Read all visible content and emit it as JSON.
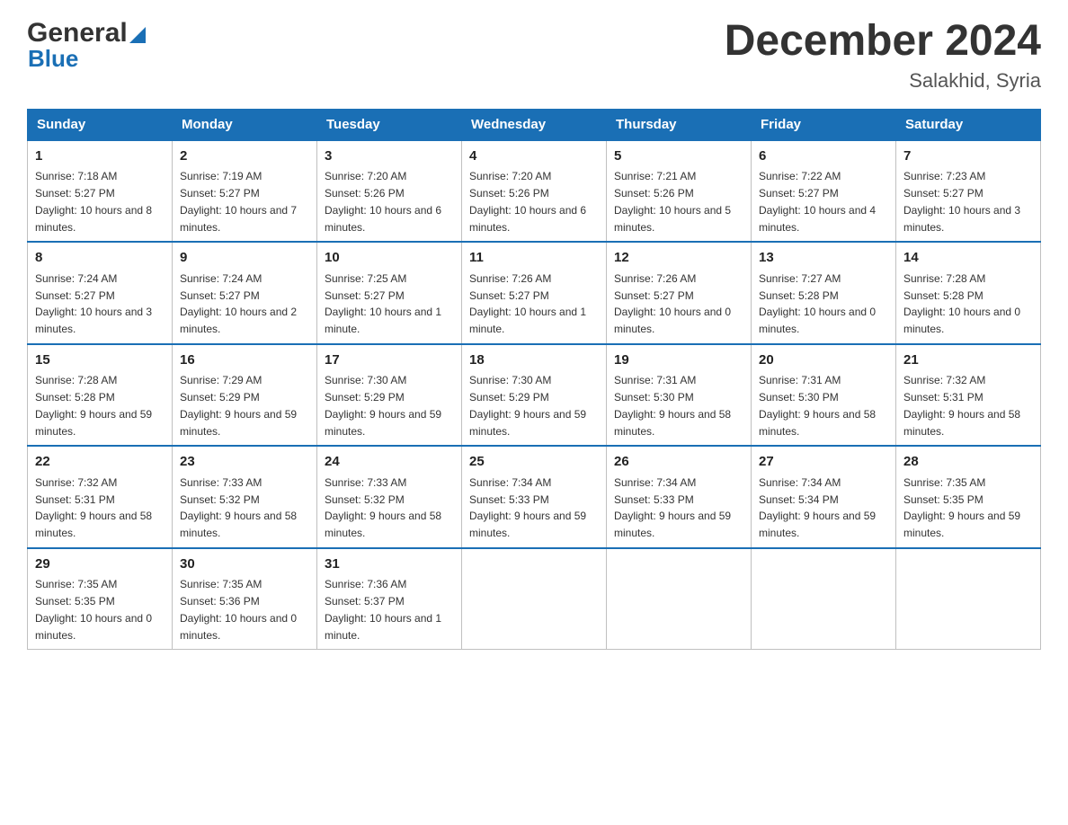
{
  "header": {
    "logo_general": "General",
    "logo_blue": "Blue",
    "main_title": "December 2024",
    "subtitle": "Salakhid, Syria"
  },
  "calendar": {
    "days_of_week": [
      "Sunday",
      "Monday",
      "Tuesday",
      "Wednesday",
      "Thursday",
      "Friday",
      "Saturday"
    ],
    "weeks": [
      [
        {
          "day": "1",
          "sunrise": "Sunrise: 7:18 AM",
          "sunset": "Sunset: 5:27 PM",
          "daylight": "Daylight: 10 hours and 8 minutes."
        },
        {
          "day": "2",
          "sunrise": "Sunrise: 7:19 AM",
          "sunset": "Sunset: 5:27 PM",
          "daylight": "Daylight: 10 hours and 7 minutes."
        },
        {
          "day": "3",
          "sunrise": "Sunrise: 7:20 AM",
          "sunset": "Sunset: 5:26 PM",
          "daylight": "Daylight: 10 hours and 6 minutes."
        },
        {
          "day": "4",
          "sunrise": "Sunrise: 7:20 AM",
          "sunset": "Sunset: 5:26 PM",
          "daylight": "Daylight: 10 hours and 6 minutes."
        },
        {
          "day": "5",
          "sunrise": "Sunrise: 7:21 AM",
          "sunset": "Sunset: 5:26 PM",
          "daylight": "Daylight: 10 hours and 5 minutes."
        },
        {
          "day": "6",
          "sunrise": "Sunrise: 7:22 AM",
          "sunset": "Sunset: 5:27 PM",
          "daylight": "Daylight: 10 hours and 4 minutes."
        },
        {
          "day": "7",
          "sunrise": "Sunrise: 7:23 AM",
          "sunset": "Sunset: 5:27 PM",
          "daylight": "Daylight: 10 hours and 3 minutes."
        }
      ],
      [
        {
          "day": "8",
          "sunrise": "Sunrise: 7:24 AM",
          "sunset": "Sunset: 5:27 PM",
          "daylight": "Daylight: 10 hours and 3 minutes."
        },
        {
          "day": "9",
          "sunrise": "Sunrise: 7:24 AM",
          "sunset": "Sunset: 5:27 PM",
          "daylight": "Daylight: 10 hours and 2 minutes."
        },
        {
          "day": "10",
          "sunrise": "Sunrise: 7:25 AM",
          "sunset": "Sunset: 5:27 PM",
          "daylight": "Daylight: 10 hours and 1 minute."
        },
        {
          "day": "11",
          "sunrise": "Sunrise: 7:26 AM",
          "sunset": "Sunset: 5:27 PM",
          "daylight": "Daylight: 10 hours and 1 minute."
        },
        {
          "day": "12",
          "sunrise": "Sunrise: 7:26 AM",
          "sunset": "Sunset: 5:27 PM",
          "daylight": "Daylight: 10 hours and 0 minutes."
        },
        {
          "day": "13",
          "sunrise": "Sunrise: 7:27 AM",
          "sunset": "Sunset: 5:28 PM",
          "daylight": "Daylight: 10 hours and 0 minutes."
        },
        {
          "day": "14",
          "sunrise": "Sunrise: 7:28 AM",
          "sunset": "Sunset: 5:28 PM",
          "daylight": "Daylight: 10 hours and 0 minutes."
        }
      ],
      [
        {
          "day": "15",
          "sunrise": "Sunrise: 7:28 AM",
          "sunset": "Sunset: 5:28 PM",
          "daylight": "Daylight: 9 hours and 59 minutes."
        },
        {
          "day": "16",
          "sunrise": "Sunrise: 7:29 AM",
          "sunset": "Sunset: 5:29 PM",
          "daylight": "Daylight: 9 hours and 59 minutes."
        },
        {
          "day": "17",
          "sunrise": "Sunrise: 7:30 AM",
          "sunset": "Sunset: 5:29 PM",
          "daylight": "Daylight: 9 hours and 59 minutes."
        },
        {
          "day": "18",
          "sunrise": "Sunrise: 7:30 AM",
          "sunset": "Sunset: 5:29 PM",
          "daylight": "Daylight: 9 hours and 59 minutes."
        },
        {
          "day": "19",
          "sunrise": "Sunrise: 7:31 AM",
          "sunset": "Sunset: 5:30 PM",
          "daylight": "Daylight: 9 hours and 58 minutes."
        },
        {
          "day": "20",
          "sunrise": "Sunrise: 7:31 AM",
          "sunset": "Sunset: 5:30 PM",
          "daylight": "Daylight: 9 hours and 58 minutes."
        },
        {
          "day": "21",
          "sunrise": "Sunrise: 7:32 AM",
          "sunset": "Sunset: 5:31 PM",
          "daylight": "Daylight: 9 hours and 58 minutes."
        }
      ],
      [
        {
          "day": "22",
          "sunrise": "Sunrise: 7:32 AM",
          "sunset": "Sunset: 5:31 PM",
          "daylight": "Daylight: 9 hours and 58 minutes."
        },
        {
          "day": "23",
          "sunrise": "Sunrise: 7:33 AM",
          "sunset": "Sunset: 5:32 PM",
          "daylight": "Daylight: 9 hours and 58 minutes."
        },
        {
          "day": "24",
          "sunrise": "Sunrise: 7:33 AM",
          "sunset": "Sunset: 5:32 PM",
          "daylight": "Daylight: 9 hours and 58 minutes."
        },
        {
          "day": "25",
          "sunrise": "Sunrise: 7:34 AM",
          "sunset": "Sunset: 5:33 PM",
          "daylight": "Daylight: 9 hours and 59 minutes."
        },
        {
          "day": "26",
          "sunrise": "Sunrise: 7:34 AM",
          "sunset": "Sunset: 5:33 PM",
          "daylight": "Daylight: 9 hours and 59 minutes."
        },
        {
          "day": "27",
          "sunrise": "Sunrise: 7:34 AM",
          "sunset": "Sunset: 5:34 PM",
          "daylight": "Daylight: 9 hours and 59 minutes."
        },
        {
          "day": "28",
          "sunrise": "Sunrise: 7:35 AM",
          "sunset": "Sunset: 5:35 PM",
          "daylight": "Daylight: 9 hours and 59 minutes."
        }
      ],
      [
        {
          "day": "29",
          "sunrise": "Sunrise: 7:35 AM",
          "sunset": "Sunset: 5:35 PM",
          "daylight": "Daylight: 10 hours and 0 minutes."
        },
        {
          "day": "30",
          "sunrise": "Sunrise: 7:35 AM",
          "sunset": "Sunset: 5:36 PM",
          "daylight": "Daylight: 10 hours and 0 minutes."
        },
        {
          "day": "31",
          "sunrise": "Sunrise: 7:36 AM",
          "sunset": "Sunset: 5:37 PM",
          "daylight": "Daylight: 10 hours and 1 minute."
        },
        null,
        null,
        null,
        null
      ]
    ]
  }
}
